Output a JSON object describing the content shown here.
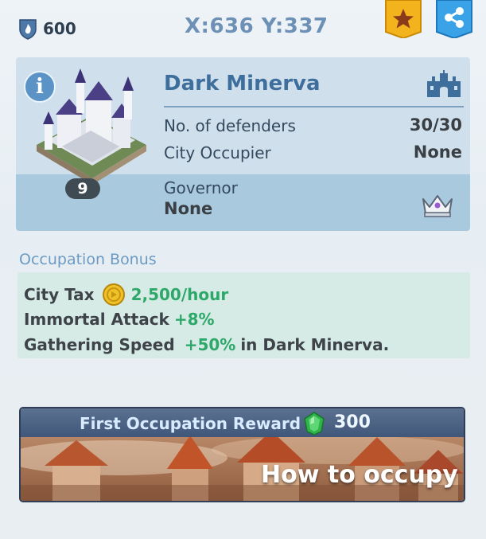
{
  "header": {
    "power_value": "600",
    "coordinates": "X:636 Y:337",
    "favorite_icon": "star-icon",
    "share_icon": "share-icon"
  },
  "city": {
    "name": "Dark Minerva",
    "level": "9",
    "defenders_label": "No. of defenders",
    "defenders_value": "30/30",
    "occupier_label": "City Occupier",
    "occupier_value": "None",
    "governor_label": "Governor",
    "governor_value": "None"
  },
  "bonus": {
    "title": "Occupation Bonus",
    "tax_label": "City Tax",
    "tax_value": "2,500/hour",
    "attack_label": "Immortal Attack",
    "attack_value": "+8%",
    "gathering_label": "Gathering Speed",
    "gathering_value": "+50%",
    "gathering_suffix": "in Dark Minerva."
  },
  "reward": {
    "title": "First Occupation Reward",
    "value": "300",
    "button_label": "How to occupy"
  },
  "colors": {
    "card": "#cfe0ec",
    "governor_band": "#a9c9df",
    "bonus_box": "#d6ebe5",
    "accent_blue": "#3e6f9c",
    "bonus_green": "#2ea86a",
    "ribbon_gold": "#f2b31c",
    "ribbon_blue": "#3aa2e6"
  }
}
